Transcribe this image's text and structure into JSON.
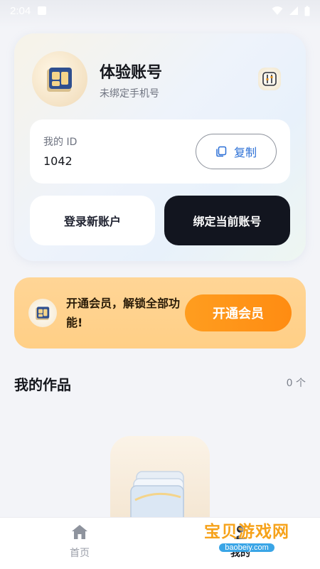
{
  "statusbar": {
    "time": "2:04"
  },
  "profile": {
    "name": "体验账号",
    "phone_status": "未绑定手机号",
    "id_label": "我的 ID",
    "id_value": "1042",
    "copy_label": "复制",
    "login_button": "登录新账户",
    "bind_button": "绑定当前账号"
  },
  "vip": {
    "promo_text": "开通会员，解锁全部功能!",
    "button": "开通会员"
  },
  "works": {
    "title": "我的作品",
    "count": "0 个"
  },
  "tabbar": {
    "home": "首页",
    "mine": "我的"
  },
  "watermark": {
    "main": "宝贝游戏网",
    "url": "baobeiy.com"
  },
  "colors": {
    "accent_orange": "#ff8c12",
    "dark_button": "#12151f",
    "copy_blue": "#2a6fd6"
  }
}
